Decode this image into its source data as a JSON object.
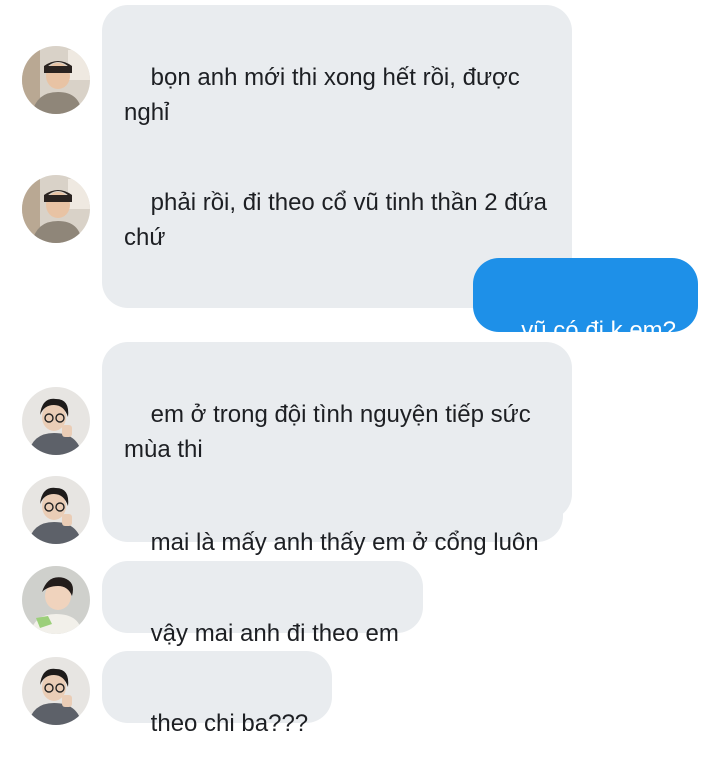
{
  "messages": [
    {
      "sender": "friend-a",
      "direction": "in",
      "text": "bọn anh mới thi xong hết rồi, được nghỉ"
    },
    {
      "sender": "friend-a",
      "direction": "in",
      "text": "phải rồi, đi theo cổ vũ tinh thần 2 đứa chứ"
    },
    {
      "sender": "me",
      "direction": "out",
      "text": "vũ có đi k em?"
    },
    {
      "sender": "friend-b",
      "direction": "in",
      "text": "em ở trong đội tình nguyện tiếp sức mùa thi"
    },
    {
      "sender": "friend-b",
      "direction": "in",
      "text": "mai là mấy anh thấy em ở cổng luôn"
    },
    {
      "sender": "friend-c",
      "direction": "in",
      "text": "vậy mai anh đi theo em"
    },
    {
      "sender": "friend-b",
      "direction": "in",
      "text": "theo chi ba???"
    }
  ],
  "colors": {
    "incoming_bubble": "#e9ecef",
    "outgoing_bubble": "#1e90e8",
    "incoming_text": "#1d1f23",
    "outgoing_text": "#ffffff"
  },
  "icons": {
    "friend-a": "avatar-photo-icon",
    "friend-b": "avatar-photo-icon",
    "friend-c": "avatar-photo-icon"
  }
}
